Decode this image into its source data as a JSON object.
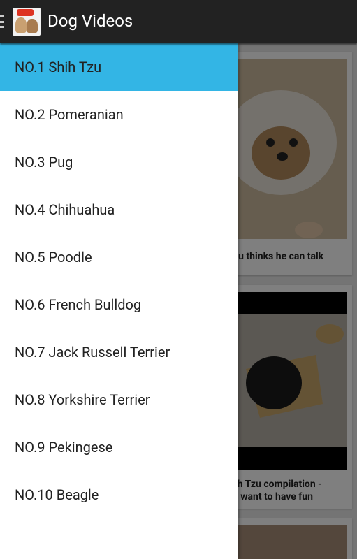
{
  "actionbar": {
    "title": "Dog Videos",
    "icon": "app-logo-icon"
  },
  "drawer": {
    "items": [
      {
        "label": "NO.1 Shih Tzu",
        "selected": true
      },
      {
        "label": "NO.2 Pomeranian"
      },
      {
        "label": "NO.3 Pug"
      },
      {
        "label": "NO.4 Chihuahua"
      },
      {
        "label": "NO.5 Poodle"
      },
      {
        "label": "NO.6 French Bulldog"
      },
      {
        "label": "NO.7 Jack Russell Terrier"
      },
      {
        "label": "NO.8 Yorkshire Terrier"
      },
      {
        "label": "NO.9 Pekingese"
      },
      {
        "label": "NO.10 Beagle"
      }
    ],
    "selected_color": "#33b5e5"
  },
  "feed": {
    "cards": [
      {
        "title": "zu thinks he can talk"
      },
      {
        "title_line1": "ih Tzu compilation -",
        "title_line2": "t want to have fun"
      }
    ]
  }
}
